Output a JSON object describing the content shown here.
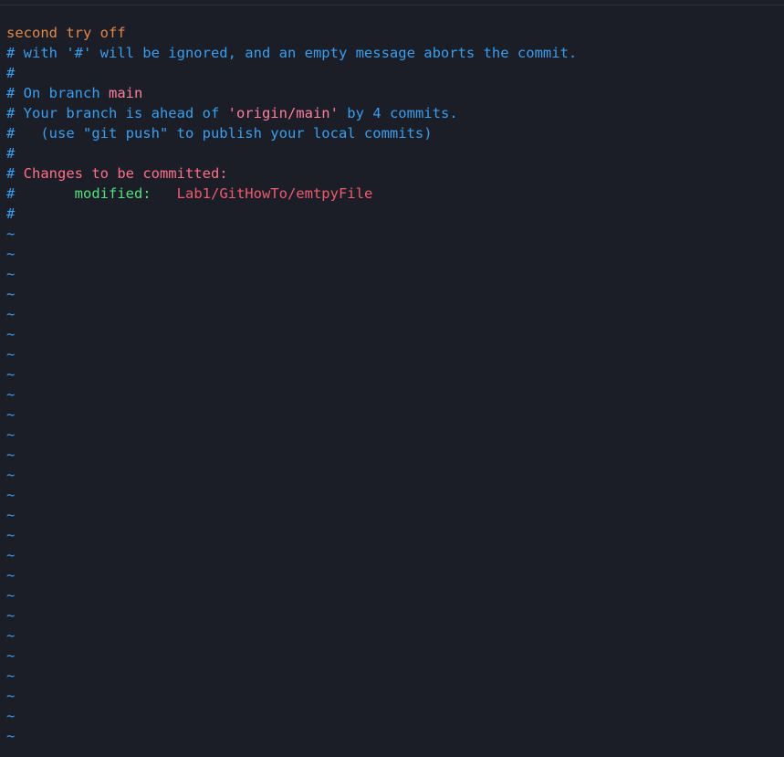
{
  "commit_message": "second try off",
  "lines": {
    "ignored_note": "# with '#' will be ignored, and an empty message aborts the commit.",
    "blank1": "#",
    "on_branch_prefix": "# On branch ",
    "branch_name": "main",
    "ahead_prefix": "# Your branch is ahead of ",
    "ahead_remote": "'origin/main'",
    "ahead_suffix": " by 4 commits.",
    "push_hint": "#   (use \"git push\" to publish your local commits)",
    "blank2": "#",
    "changes_hash": "# ",
    "changes_header": "Changes to be committed:",
    "modified_hash": "#       ",
    "modified_label": "modified:",
    "modified_gap": "   ",
    "modified_file": "Lab1/GitHowTo/emtpyFile",
    "blank3": "#"
  },
  "tilde": "~",
  "colors": {
    "background": "#1b1e27",
    "message": "#e0874c",
    "comment": "#3a9eee",
    "branch": "#ff7f9f",
    "changes_header": "#ff6f8a",
    "modified": "#52e07d",
    "file": "#f05a6e"
  }
}
